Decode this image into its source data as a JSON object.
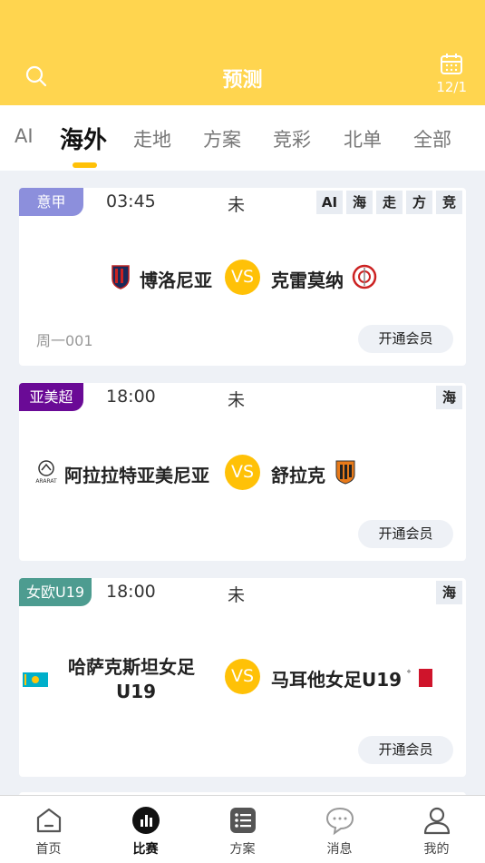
{
  "header": {
    "title": "预测",
    "date": "12/1",
    "colors": {
      "bg": "#ffd54f"
    }
  },
  "tabs": [
    {
      "label": "AI"
    },
    {
      "label": "海外"
    },
    {
      "label": "走地"
    },
    {
      "label": "方案"
    },
    {
      "label": "竞彩"
    },
    {
      "label": "北单"
    },
    {
      "label": "全部"
    }
  ],
  "matches": [
    {
      "league": "意甲",
      "league_color": "#8c8fdc",
      "time": "03:45",
      "status": "未",
      "badges": [
        "AI",
        "海",
        "走",
        "方",
        "竞"
      ],
      "home": "博洛尼亚",
      "away": "克雷莫纳",
      "vs": "VS",
      "weekday": "周一001",
      "button": "开通会员"
    },
    {
      "league": "亚美超",
      "league_color": "#6a0a96",
      "time": "18:00",
      "status": "未",
      "badges": [
        "海"
      ],
      "home": "阿拉拉特亚美尼亚",
      "away": "舒拉克",
      "vs": "VS",
      "weekday": "",
      "button": "开通会员"
    },
    {
      "league": "女欧U19",
      "league_color": "#4d9c90",
      "time": "18:00",
      "status": "未",
      "badges": [
        "海"
      ],
      "home_line1": "哈萨克斯坦女足",
      "home_line2": "U19",
      "away": "马耳他女足U19",
      "vs": "VS",
      "weekday": "",
      "button": "开通会员"
    }
  ],
  "bottom_nav": [
    {
      "label": "首页",
      "icon": "home-icon"
    },
    {
      "label": "比赛",
      "icon": "match-icon"
    },
    {
      "label": "方案",
      "icon": "plan-icon"
    },
    {
      "label": "消息",
      "icon": "message-icon"
    },
    {
      "label": "我的",
      "icon": "profile-icon"
    }
  ]
}
